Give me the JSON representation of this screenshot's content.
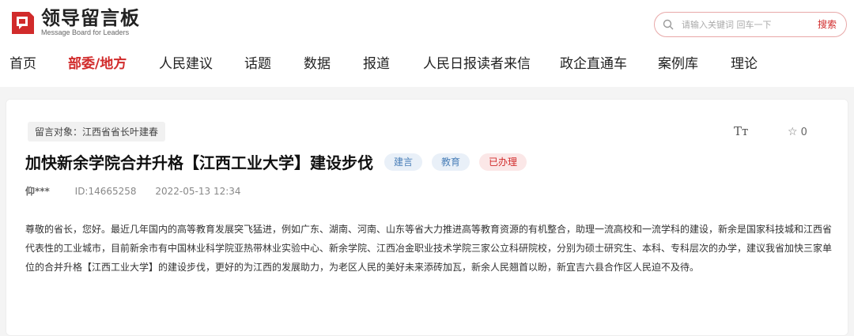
{
  "logo": {
    "title": "领导留言板",
    "subtitle": "Message Board for Leaders",
    "icon": "logo-mark-icon"
  },
  "search": {
    "placeholder": "请输入关键词 回车一下",
    "button_label": "搜索"
  },
  "nav": {
    "items": [
      {
        "label": "首页"
      },
      {
        "label": "部委/地方",
        "active": true
      },
      {
        "label": "人民建议"
      },
      {
        "label": "话题"
      },
      {
        "label": "数据"
      },
      {
        "label": "报道"
      },
      {
        "label": "人民日报读者来信"
      },
      {
        "label": "政企直通车"
      },
      {
        "label": "案例库"
      },
      {
        "label": "理论"
      }
    ]
  },
  "message": {
    "recipient": "留言对象：江西省省长叶建春",
    "font_toggle": "Tт",
    "favorite_count": "0",
    "title": "加快新余学院合并升格【江西工业大学】建设步伐",
    "badges": {
      "type": "建言",
      "domain": "教育",
      "status": "已办理"
    },
    "author": "仰***",
    "id": "ID:14665258",
    "datetime": "2022-05-13 12:34",
    "body": "尊敬的省长，您好。最近几年国内的高等教育发展突飞猛进，例如广东、湖南、河南、山东等省大力推进高等教育资源的有机整合，助理一流高校和一流学科的建设，新余是国家科技城和江西省代表性的工业城市，目前新余市有中国林业科学院亚热带林业实验中心、新余学院、江西冶金职业技术学院三家公立科研院校，分别为硕士研究生、本科、专科层次的办学，建议我省加快三家单位的合并升格【江西工业大学】的建设步伐，更好的为江西的发展助力，为老区人民的美好未来添砖加瓦，新余人民翘首以盼，新宜吉六县合作区人民迫不及待。"
  },
  "colors": {
    "brand_red": "#d12b2b",
    "badge_blue_bg": "#e9f0f8",
    "badge_red_bg": "#fbe7e7"
  }
}
